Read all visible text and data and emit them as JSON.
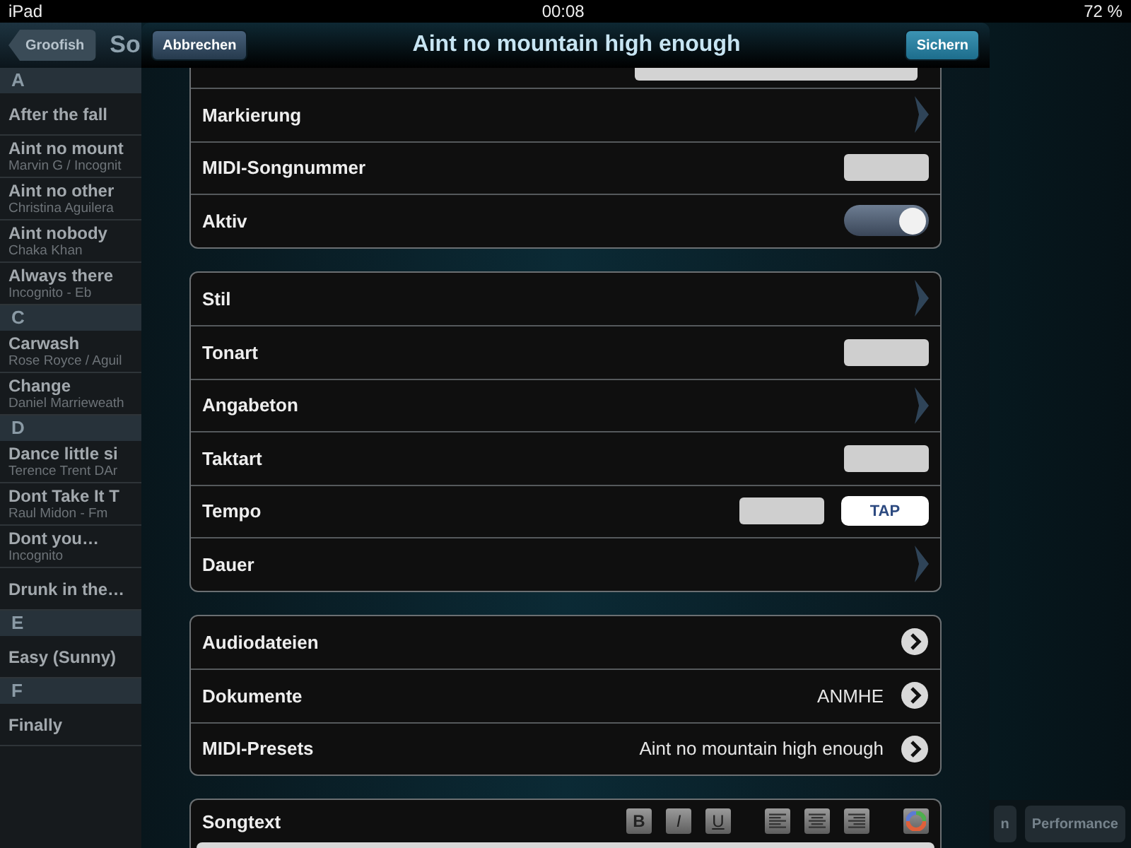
{
  "status_bar": {
    "device": "iPad",
    "time": "00:08",
    "battery": "72 %"
  },
  "background": {
    "back_button": "Groofish",
    "title": "So",
    "sections": [
      {
        "letter": "A",
        "songs": [
          {
            "title": "After the fall"
          },
          {
            "title": "Aint no mount",
            "artist": "Marvin G / Incognit"
          },
          {
            "title": "Aint no other",
            "artist": "Christina Aguilera"
          },
          {
            "title": "Aint nobody",
            "artist": "Chaka Khan"
          },
          {
            "title": "Always there",
            "artist": "Incognito - Eb"
          }
        ]
      },
      {
        "letter": "C",
        "songs": [
          {
            "title": "Carwash",
            "artist": "Rose Royce / Aguil"
          },
          {
            "title": "Change",
            "artist": "Daniel Marrieweath"
          }
        ]
      },
      {
        "letter": "D",
        "songs": [
          {
            "title": "Dance little si",
            "artist": "Terence Trent DAr"
          },
          {
            "title": "Dont Take It T",
            "artist": "Raul Midon - Fm"
          },
          {
            "title": "Dont you…",
            "artist": "Incognito"
          },
          {
            "title": "Drunk in the…"
          }
        ]
      },
      {
        "letter": "E",
        "songs": [
          {
            "title": "Easy (Sunny)"
          }
        ]
      },
      {
        "letter": "F",
        "songs": [
          {
            "title": "Finally"
          }
        ]
      }
    ],
    "toolbar_buttons": [
      "n",
      "Performance"
    ]
  },
  "modal": {
    "cancel": "Abbrechen",
    "title": "Aint no mountain high enough",
    "save": "Sichern",
    "groups": [
      {
        "rows": [
          {
            "kind": "field"
          },
          {
            "kind": "disclosure",
            "label": "Markierung"
          },
          {
            "kind": "input",
            "label": "MIDI-Songnummer"
          },
          {
            "kind": "switch",
            "label": "Aktiv",
            "on": true
          }
        ]
      },
      {
        "rows": [
          {
            "kind": "disclosure",
            "label": "Stil"
          },
          {
            "kind": "input",
            "label": "Tonart"
          },
          {
            "kind": "disclosure",
            "label": "Angabeton"
          },
          {
            "kind": "input",
            "label": "Taktart"
          },
          {
            "kind": "tempo",
            "label": "Tempo",
            "button": "TAP"
          },
          {
            "kind": "disclosure",
            "label": "Dauer"
          }
        ]
      },
      {
        "rows": [
          {
            "kind": "detail",
            "label": "Audiodateien"
          },
          {
            "kind": "detail",
            "label": "Dokumente",
            "value": "ANMHE"
          },
          {
            "kind": "detail",
            "label": "MIDI-Presets",
            "value": "Aint no mountain high enough"
          }
        ]
      }
    ],
    "songtext": {
      "label": "Songtext",
      "tools": [
        {
          "kind": "bold",
          "label": "B"
        },
        {
          "kind": "italic",
          "label": "I"
        },
        {
          "kind": "underline",
          "label": "U"
        },
        {
          "kind": "align-left"
        },
        {
          "kind": "align-center"
        },
        {
          "kind": "align-right"
        },
        {
          "kind": "color"
        }
      ]
    }
  }
}
